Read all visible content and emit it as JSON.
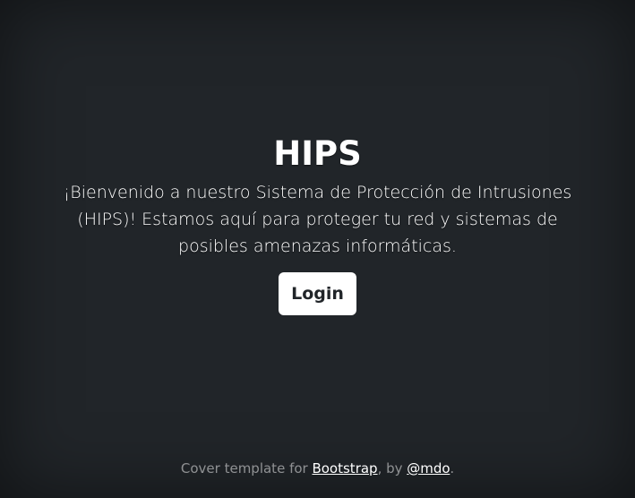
{
  "main": {
    "title": "HIPS",
    "lead": "¡Bienvenido a nuestro Sistema de Protección de Intrusiones (HIPS)! Estamos aquí para proteger tu red y sistemas de posibles amenazas informáticas.",
    "login_label": "Login"
  },
  "footer": {
    "prefix": "Cover template for ",
    "bootstrap_link": "Bootstrap",
    "middle": ", by ",
    "mdo_link": "@mdo",
    "suffix": "."
  },
  "colors": {
    "background": "#212529",
    "text": "#ffffff",
    "muted": "#9a9c9e"
  }
}
